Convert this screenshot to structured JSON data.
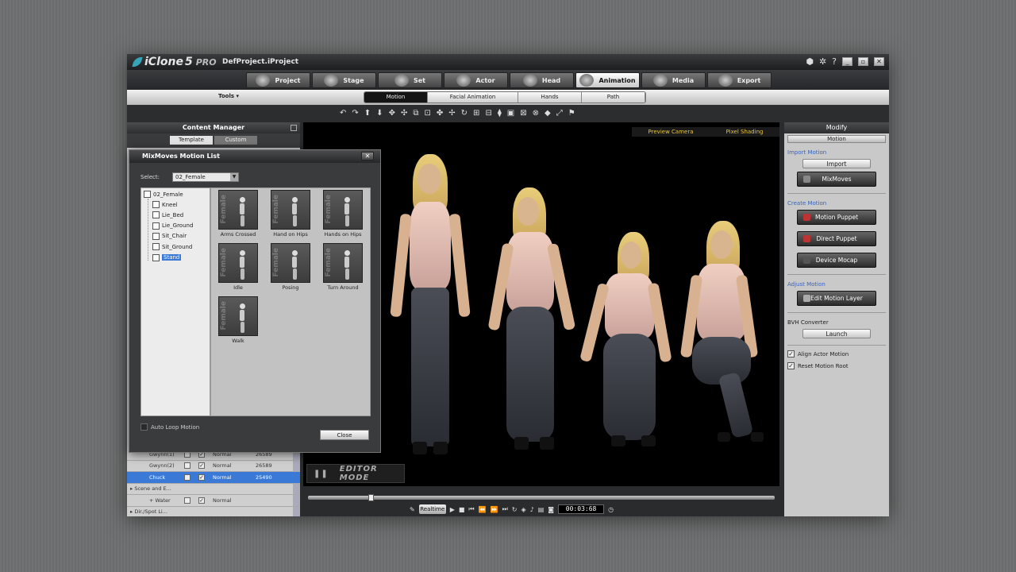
{
  "window": {
    "brand": "iClone",
    "version": "5",
    "edition": "PRO",
    "project": "DefProject.iProject"
  },
  "main_tabs": [
    {
      "label": "Project",
      "icon": "project-icon"
    },
    {
      "label": "Stage",
      "icon": "stage-icon"
    },
    {
      "label": "Set",
      "icon": "set-icon"
    },
    {
      "label": "Actor",
      "icon": "actor-icon"
    },
    {
      "label": "Head",
      "icon": "head-icon"
    },
    {
      "label": "Animation",
      "icon": "animation-icon",
      "active": true
    },
    {
      "label": "Media",
      "icon": "media-icon"
    },
    {
      "label": "Export",
      "icon": "export-icon"
    }
  ],
  "tools_label": "Tools ▾",
  "sub_tabs": [
    {
      "label": "Motion",
      "active": true
    },
    {
      "label": "Facial Animation"
    },
    {
      "label": "Hands"
    },
    {
      "label": "Path"
    }
  ],
  "content_manager": {
    "title": "Content Manager",
    "tabs": [
      "Template",
      "Custom"
    ]
  },
  "scene_rows": [
    {
      "name": "Gwynn(1)",
      "checked": "✓",
      "mode": "Normal",
      "frames": "26589"
    },
    {
      "name": "Gwynn(2)",
      "checked": "✓",
      "mode": "Normal",
      "frames": "26589"
    },
    {
      "name": "Chuck",
      "checked": "✓",
      "mode": "Normal",
      "frames": "25490",
      "selected": true
    },
    {
      "group": "Scene and E..."
    },
    {
      "name": "Water",
      "prefix": "+",
      "checked": "✓",
      "mode": "Normal"
    },
    {
      "group": "Dir./Spot Li..."
    }
  ],
  "dialog": {
    "title": "MixMoves Motion List",
    "select_label": "Select:",
    "select_value": "02_Female",
    "tree_root": "02_Female",
    "tree_items": [
      "Kneel",
      "Lie_Bed",
      "Lie_Ground",
      "Sit_Chair",
      "Sit_Ground",
      "Stand"
    ],
    "tree_selected": "Stand",
    "thumbs": [
      "Arms Crossed",
      "Hand on Hips",
      "Hands on Hips",
      "Idle",
      "Posing",
      "Turn Around",
      "Walk"
    ],
    "thumb_watermark": "Female",
    "auto_loop": "Auto Loop Motion",
    "close": "Close"
  },
  "viewport": {
    "camera": "Preview Camera",
    "shading": "Pixel Shading",
    "editor_mode": "EDITOR MODE"
  },
  "timeline": {
    "realtime": "Realtime",
    "timecode": "00:03:68",
    "progress": 0.13
  },
  "modify": {
    "title": "Modify",
    "select": "Motion",
    "import_section": "Import Motion",
    "import_btn": "Import",
    "mixmoves_btn": "MixMoves",
    "create_section": "Create Motion",
    "motion_puppet": "Motion Puppet",
    "direct_puppet": "Direct Puppet",
    "device_mocap": "Device Mocap",
    "adjust_section": "Adjust Motion",
    "edit_layer": "Edit Motion Layer",
    "bvh_section": "BVH Converter",
    "launch": "Launch",
    "align_actor": "Align Actor Motion",
    "reset_root": "Reset Motion Root"
  }
}
